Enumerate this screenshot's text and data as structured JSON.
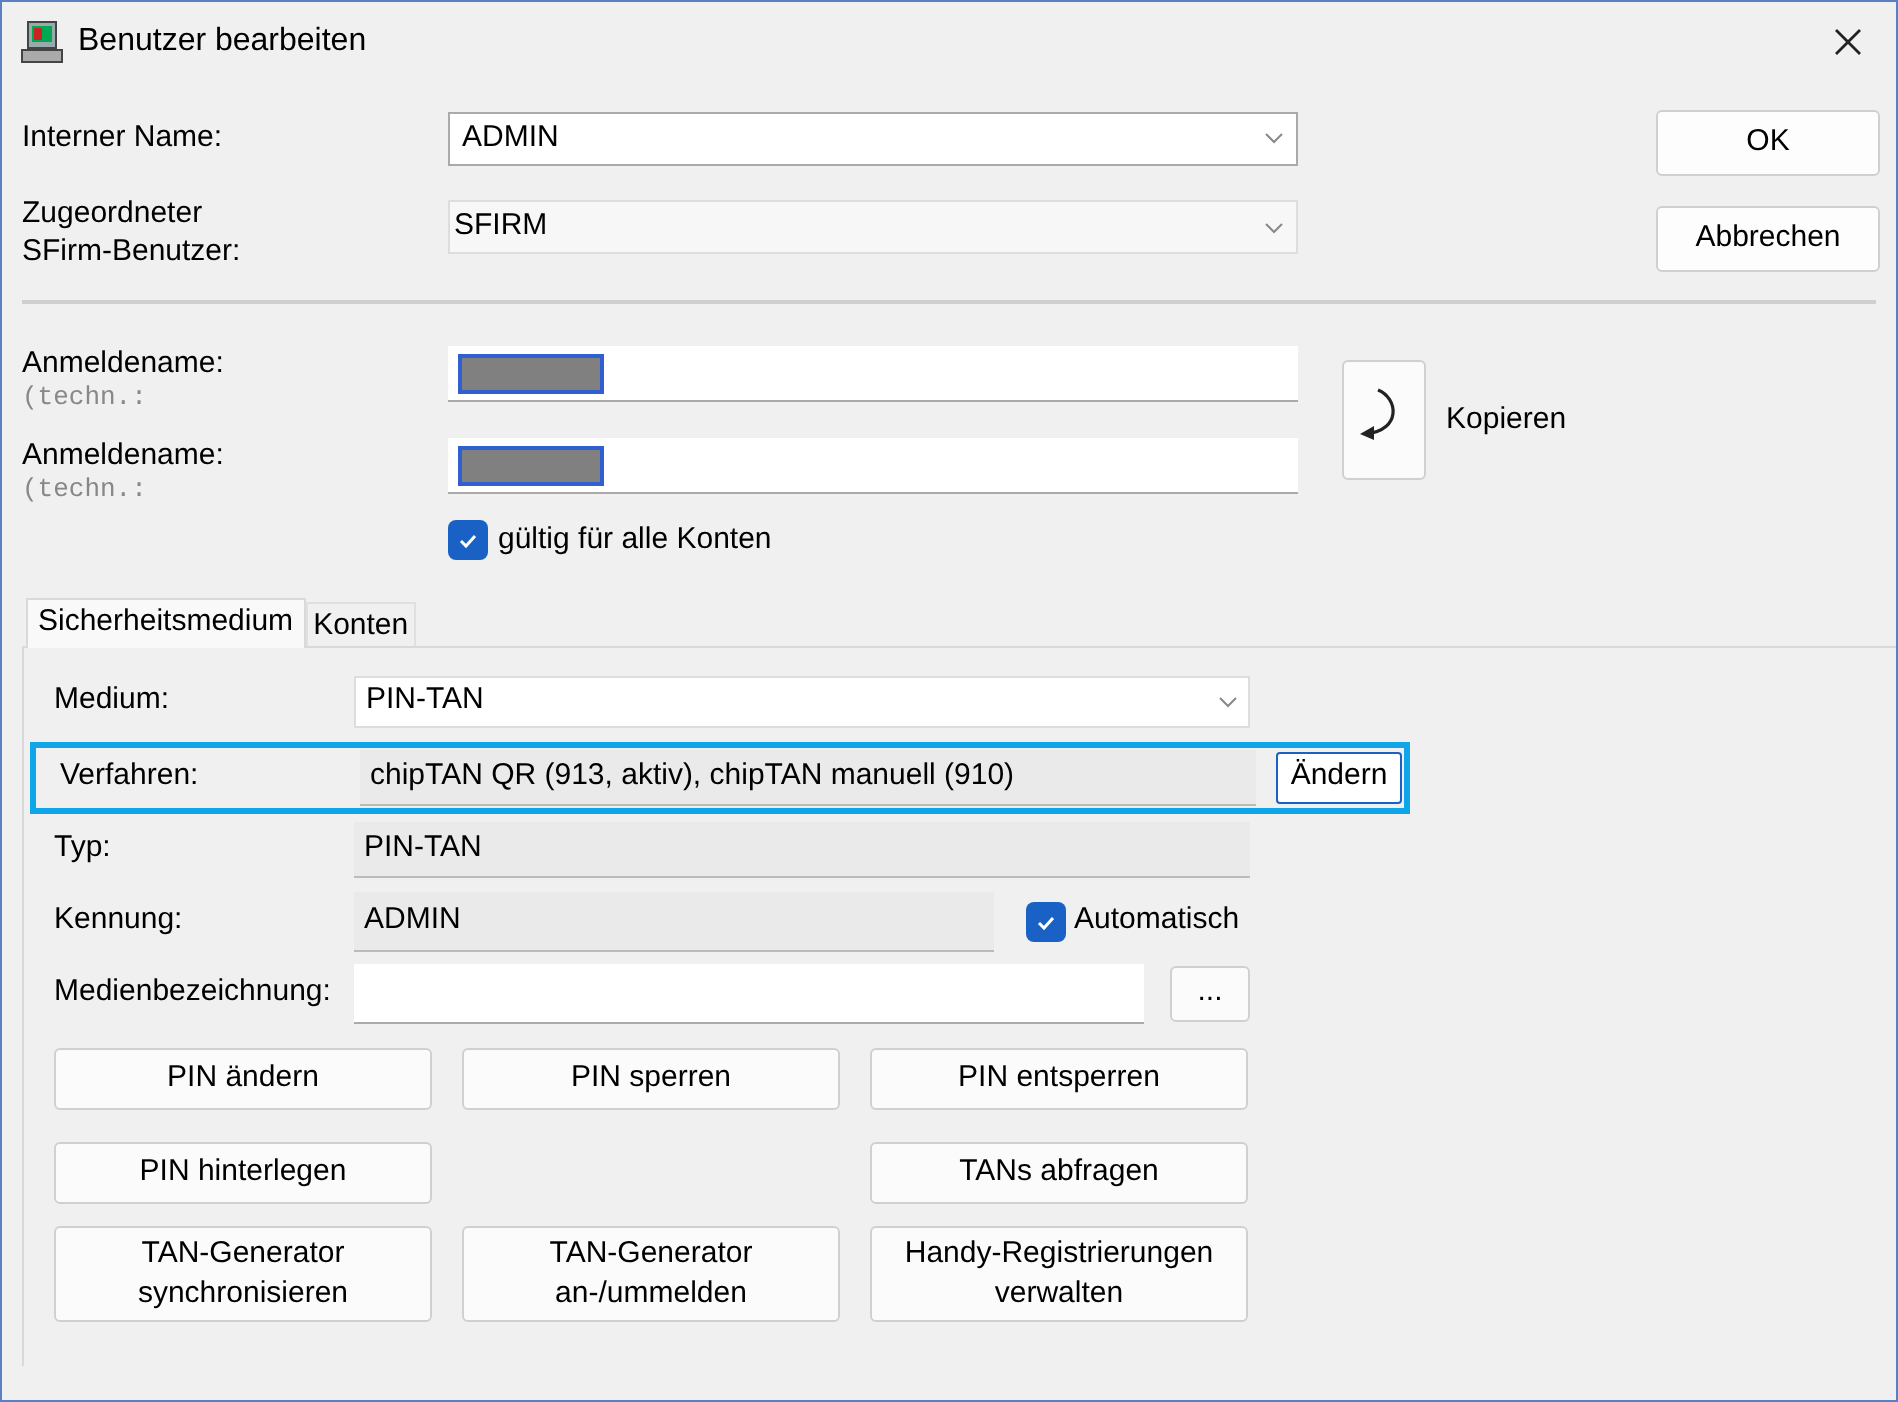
{
  "window": {
    "title": "Benutzer bearbeiten"
  },
  "interner_name": {
    "label": "Interner Name:",
    "value": "ADMIN"
  },
  "sfirm_benutzer": {
    "label_lines": [
      "Zugeordneter",
      "SFirm-Benutzer:"
    ],
    "value": "SFIRM"
  },
  "dialog_buttons": [
    "OK",
    "Abbrechen"
  ],
  "anmeldenamen": [
    {
      "label": "Anmeldename:",
      "hint": "(techn.:"
    },
    {
      "label": "Anmeldename:",
      "hint": "(techn.:"
    }
  ],
  "kopieren": {
    "label": "Kopieren"
  },
  "gueltig": {
    "label": "gültig für alle Konten",
    "checked": true
  },
  "tabs": [
    {
      "label": "Sicherheitsmedium",
      "selected": true
    },
    {
      "label": "Konten",
      "selected": false
    }
  ],
  "medium": {
    "label": "Medium:",
    "value": "PIN-TAN"
  },
  "verfahren": {
    "label": "Verfahren:",
    "value": "chipTAN QR (913, aktiv), chipTAN manuell (910)",
    "button": "Ändern",
    "highlighted": true
  },
  "typ": {
    "label": "Typ:",
    "value": "PIN-TAN"
  },
  "kennung": {
    "label": "Kennung:",
    "value": "ADMIN",
    "auto_label": "Automatisch",
    "auto_checked": true
  },
  "medienbezeichnung": {
    "label": "Medienbezeichnung:",
    "button": "..."
  },
  "action_rows": [
    {
      "left": [
        "PIN ändern"
      ],
      "middle": [
        "PIN sperren"
      ],
      "right": [
        "PIN entsperren"
      ]
    },
    {
      "left": [
        "PIN hinterlegen"
      ],
      "right": [
        "TANs abfragen"
      ]
    },
    {
      "left": [
        "TAN-Generator",
        "synchronisieren"
      ],
      "middle": [
        "TAN-Generator",
        "an-/ummelden"
      ],
      "right": [
        "Handy-Registrierungen",
        "verwalten"
      ]
    }
  ]
}
